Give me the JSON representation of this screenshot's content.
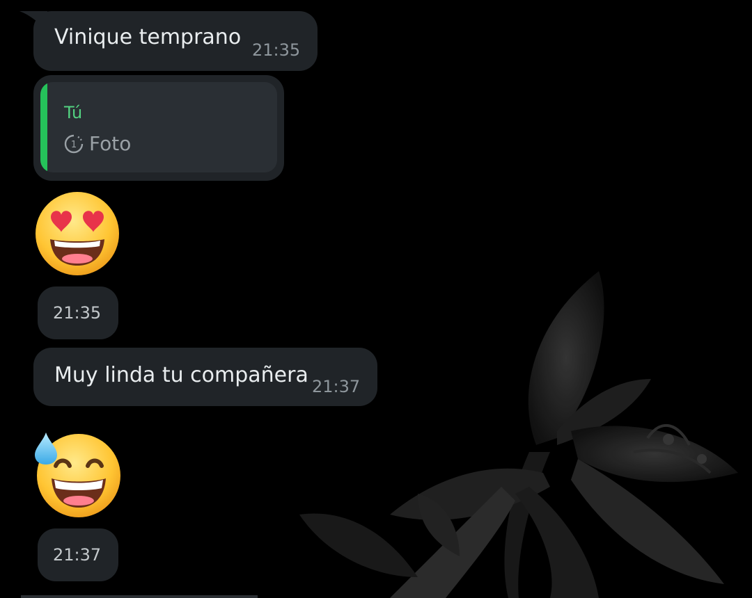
{
  "messages": [
    {
      "type": "text",
      "text": "Vinique temprano",
      "time": "21:35"
    },
    {
      "type": "reply",
      "quoted_author": "Tú",
      "quoted_media_icon": "view-once-icon",
      "quoted_media_count": "1",
      "quoted_media_label": "Foto"
    },
    {
      "type": "emoji",
      "emoji": "smiling-face-with-heart-eyes",
      "time": "21:35"
    },
    {
      "type": "text",
      "text": "Muy linda tu compañera",
      "time": "21:37"
    },
    {
      "type": "emoji",
      "emoji": "grinning-face-with-sweat",
      "time": "21:37"
    }
  ],
  "colors": {
    "bubble": "#202428",
    "reply_bar": "#25c25a",
    "reply_author": "#53d281",
    "background": "#000000"
  }
}
